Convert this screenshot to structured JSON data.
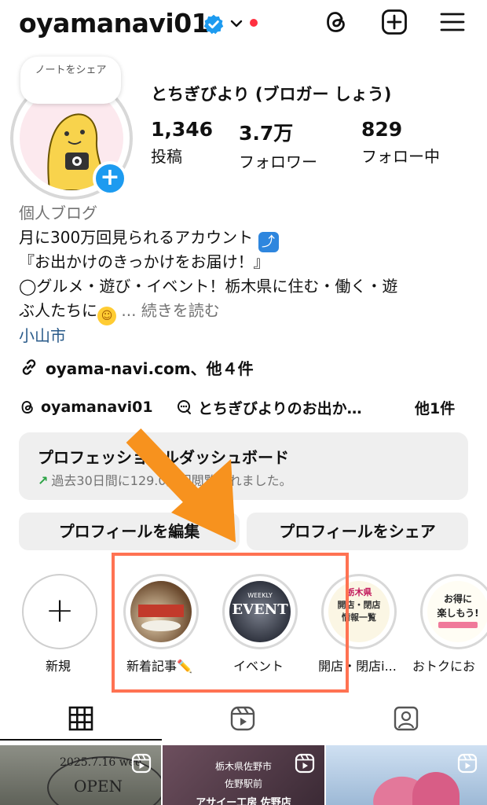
{
  "header": {
    "username": "oyamanavi01",
    "icons": [
      "verified-badge-icon",
      "chevron-down-icon",
      "notification-dot",
      "threads-icon",
      "create-icon",
      "menu-icon"
    ]
  },
  "profile": {
    "note_text": "ノートをシェア",
    "full_name": "とちぎびより (ブロガー しょう)",
    "stats": {
      "posts_count": "1,346",
      "posts_label": "投稿",
      "followers_count": "3.7万",
      "followers_label": "フォロワー",
      "following_count": "829",
      "following_label": "フォロー中"
    },
    "category": "個人ブログ",
    "bio_line1": "月に300万回見られるアカウント",
    "bio_line2": "『お出かけのきっかけをお届け！』",
    "bio_line3": "◯グルメ・遊び・イベント！栃木県に住む・働く・遊",
    "bio_line4": "ぶ人たちに",
    "more_label": "... 続きを読む",
    "location": "小山市",
    "link_text": "oyama-navi.com、他４件",
    "threads_handle": "oyamanavi01",
    "threads_channel": "とちぎびよりのお出か…",
    "threads_more": "他1件"
  },
  "dashboard": {
    "title": "プロフェッショナルダッシュボード",
    "subtitle": "過去30日間に129.0万回閲覧されました。"
  },
  "buttons": {
    "edit_profile": "プロフィールを編集",
    "share_profile": "プロフィールをシェア"
  },
  "highlights": [
    {
      "label": "新規"
    },
    {
      "label": "新着記事✏️"
    },
    {
      "label": "イベント"
    },
    {
      "label": "開店・閉店i..."
    },
    {
      "label": "おトクにお"
    }
  ],
  "highlight_images": {
    "event_word": "EVENT",
    "weekly_word": "WEEKLY",
    "openclose_title": "栃木県",
    "openclose_lines": [
      "開店・閉店",
      "情報一覧"
    ],
    "deal_lines": [
      "お得に",
      "楽しもう!"
    ]
  },
  "tabs": [
    "grid-icon",
    "reels-icon",
    "tagged-icon"
  ],
  "grid": {
    "post1_text": "2025.7.16 wed",
    "post1_open": "OPEN",
    "post2_lines": [
      "栃木県佐野市",
      "佐野駅前",
      "アサイー工房 佐野店"
    ]
  },
  "colors": {
    "accent_blue": "#1d9bf0",
    "link_blue": "#2a5b8a",
    "notification_red": "#ff3040",
    "annotation_orange": "#f7921e",
    "annotation_box": "#ff7252",
    "muted_gray": "#737373",
    "button_bg": "#efefef"
  }
}
